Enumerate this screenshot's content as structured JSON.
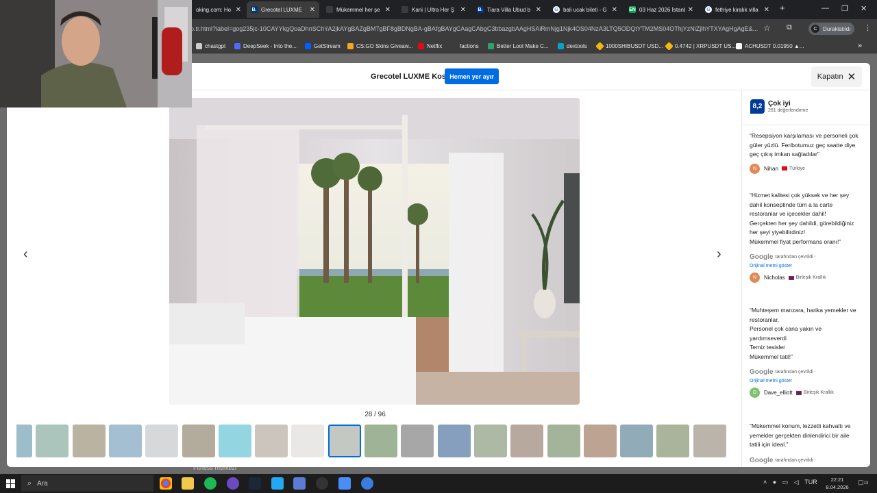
{
  "browser": {
    "tabs": [
      {
        "label": "oking.com: Ho",
        "favicon": "booking-icon",
        "color": "#003580",
        "letter": ""
      },
      {
        "label": "Grecotel LUXME",
        "favicon": "booking-icon",
        "color": "#003580",
        "letter": "B.",
        "active": true
      },
      {
        "label": "Mükemmel her şe",
        "favicon": "booking-icon",
        "color": "#003580",
        "letter": ""
      },
      {
        "label": "Kani | Ultra Her Ş",
        "favicon": "booking-icon",
        "color": "#003580",
        "letter": ""
      },
      {
        "label": "Tiara Villa Ubud b",
        "favicon": "booking-icon",
        "color": "#003580",
        "letter": "B."
      },
      {
        "label": "bali ucak bileti - G",
        "favicon": "google-icon",
        "color": "#ffffff",
        "letter": ""
      },
      {
        "label": "03 Haz 2026 İstanb",
        "favicon": "sheet-icon",
        "color": "#0f9d58",
        "letter": "EN"
      },
      {
        "label": "fethiye kiralık villa",
        "favicon": "google-icon",
        "color": "#ffffff",
        "letter": ""
      }
    ],
    "new_tab": "+",
    "url": "b.tr.html?label=gog235jc-10CAYYkgQoaDhnSChYA2jkAYgBAZgBM7gBF8gBDNgBA-gBAfgBAYgCAagCAbgC3bbazgbAAgHSAiRmNjg1Njk4OS04NzA3LTQ5ODQtYTM2MS04OThjYzNiZjlhYTXYAgHgAgE&...",
    "profile": {
      "initial": "C",
      "label": "Duraklatıldı"
    },
    "bookmarks": [
      {
        "label": "chastgpt",
        "color": "#cccccc"
      },
      {
        "label": "DeepSeek - Into the...",
        "color": "#4d6bfe"
      },
      {
        "label": "GetStream",
        "color": "#005fff"
      },
      {
        "label": "CS:GO Skins Giveaw...",
        "color": "#f5a623"
      },
      {
        "label": "Netflix",
        "color": "#e50914"
      },
      {
        "label": "factions",
        "color": "#3c3c3c"
      },
      {
        "label": "Better Loot Make C...",
        "color": "#29a36a"
      },
      {
        "label": "dextools",
        "color": "#05a3c9"
      },
      {
        "label": "1000SHIBUSDT USD...",
        "color": "#f0b90b"
      },
      {
        "label": "0.4742 | XRPUSDT US...",
        "color": "#f0b90b"
      },
      {
        "label": "ACHUSDT 0.01950 ▲...",
        "color": "#ffffff"
      }
    ],
    "more": "»"
  },
  "gallery": {
    "hotel_name": "Grecotel LUXME Kos",
    "reserve_label": "Hemen yer ayır",
    "close_label": "Kapatın",
    "counter": "28 / 96",
    "current_index": 28,
    "total": 96,
    "thumbnail_count": 20,
    "selected_thumbnail": 9
  },
  "reviews": {
    "score": "8,2",
    "score_word": "Çok iyi",
    "count": "261 değerlendirme",
    "items": [
      {
        "text": "“Resepsiyon karşılaması ve personeli çok güler yüzlü. Feribotumuz geç saatte diye geç çıkış imkan sağladılar”",
        "translated": false,
        "initial": "N",
        "author": "Nihan",
        "country": "Türkiye",
        "avatar_color": "#e08a55"
      },
      {
        "text": "“Hizmet kalitesi çok yüksek ve her şey dahil konseptinde tüm a la carte restoranlar ve içecekler dahil!\nGerçekten her şey dahildi, görebildiğiniz her şeyi yiyebilirdiniz!\nMükemmel fiyat performans oranı!”",
        "translated": true,
        "initial": "N",
        "author": "Nicholas",
        "country": "Birleşik Krallık",
        "avatar_color": "#e08a55"
      },
      {
        "text": "“Muhteşem manzara, harika yemekler ve restoranlar.\nPersonel çok cana yakın ve yardımseverdi\nTemiz tesisler\nMükemmel tatil!”",
        "translated": true,
        "initial": "D",
        "author": "Dave_elliott",
        "country": "Birleşik Krallık",
        "avatar_color": "#7cc36b"
      },
      {
        "text": "“Mükemmel konum, lezzetli kahvaltı ve yemekler gerçekten dinlendirici bir aile tatili için ideal.”",
        "translated": true,
        "initial": "",
        "author": "",
        "country": "",
        "avatar_color": "#cccccc"
      }
    ],
    "google_label": "Google",
    "translated_by": "tarafından çevrildi",
    "show_original": "Orijinal metni göster"
  },
  "underlying_page": {
    "fitness_label": "Fitness merkezi"
  },
  "taskbar": {
    "search_placeholder": "Ara",
    "language": "TUR",
    "time": "22:21",
    "date": "8.04.2026",
    "notifications": "13"
  }
}
